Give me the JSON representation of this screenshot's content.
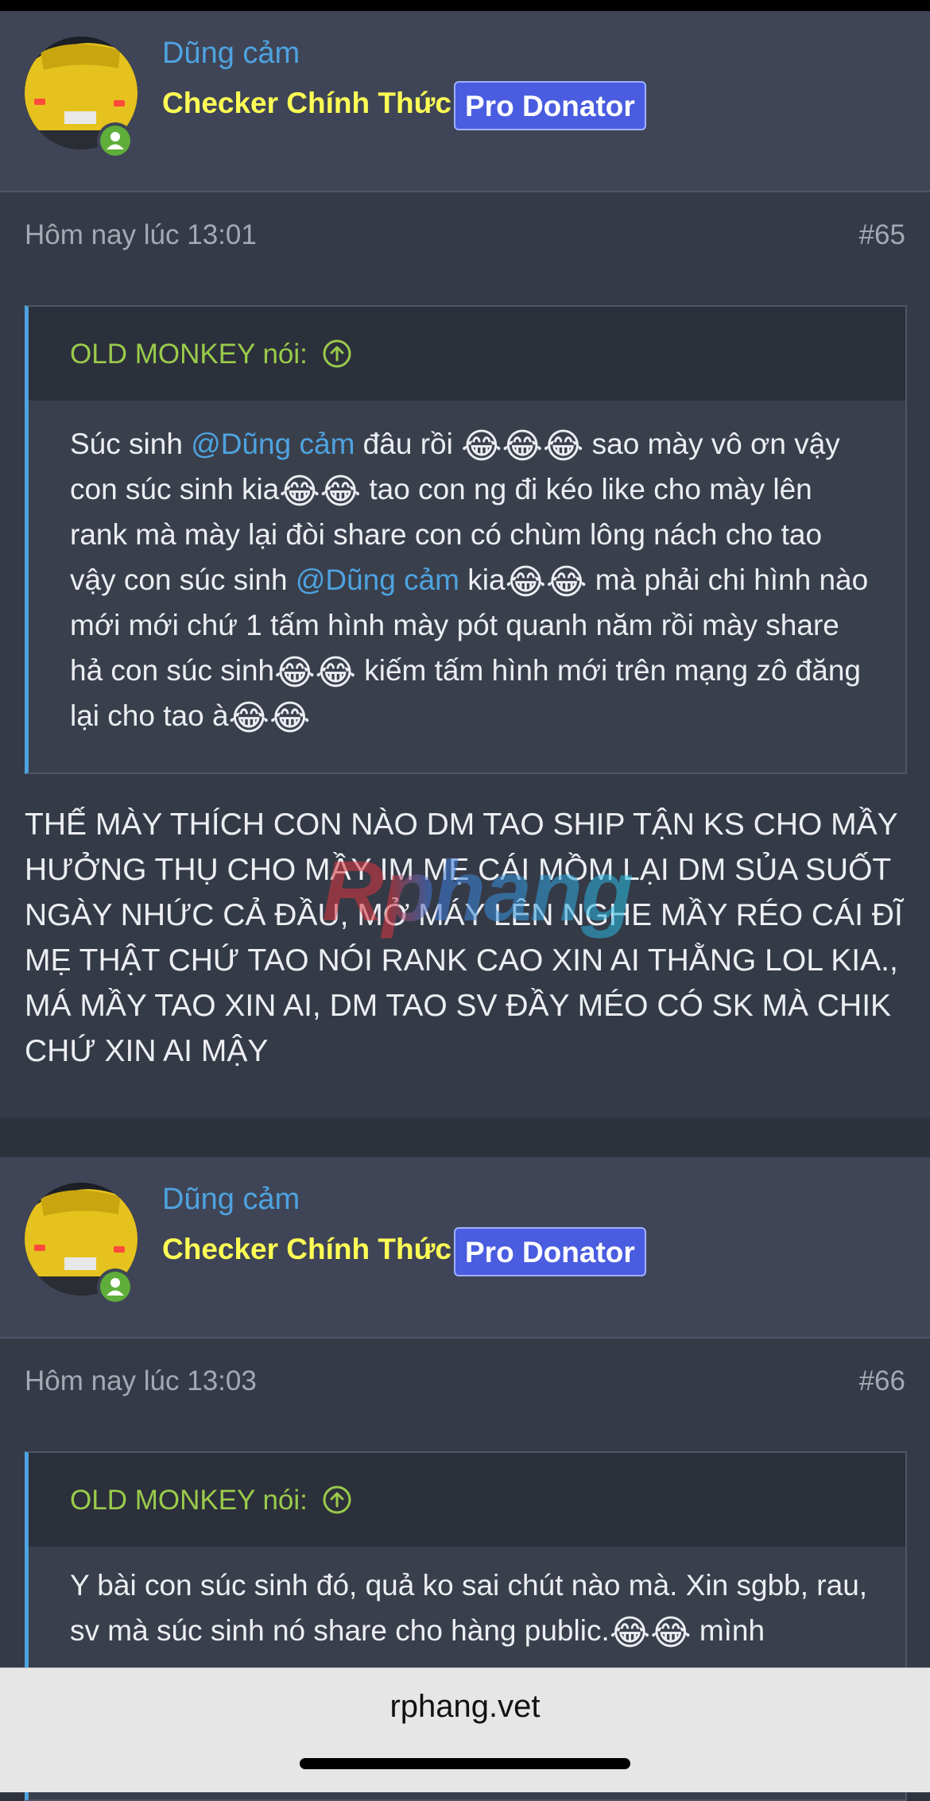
{
  "posts": [
    {
      "username": "Dũng cảm",
      "user_title": "Checker Chính Thức",
      "badge": "Pro Donator",
      "time": "Hôm nay lúc 13:01",
      "post_number": "#65",
      "quote": {
        "author_label": "OLD MONKEY nói:",
        "text": [
          "Súc sinh ",
          "@Dũng cảm",
          " đâu rồi ",
          "😂😂😂",
          " sao mày vô ơn vậy con súc sinh kia",
          "😂😂",
          " tao con ng đi kéo like cho mày lên rank mà mày lại đòi share con có chùm lông nách cho tao vậy con súc sinh ",
          "@Dũng cảm",
          " kia",
          "😂😂",
          " mà phải chi hình nào mới mới chứ 1 tấm hình mày pót quanh năm rồi mày share hả con súc sinh",
          "😂😂",
          " kiếm tấm hình mới trên mạng zô đăng lại cho tao à",
          "😂😂"
        ]
      },
      "body": "THẾ MÀY THÍCH CON NÀO DM TAO SHIP TẬN KS CHO MẦY HƯỞNG THỤ CHO MẦY IM MẸ CÁI MỒM LẠI DM SỦA SUỐT NGÀY NHỨC CẢ ĐẦU, MỞ MÁY LÊN NGHE MẦY RÉO CÁI ĐĨ MẸ THẬT CHỨ TAO NÓI RANK CAO XIN AI THẰNG LOL KIA., MÁ MẦY TAO XIN AI, DM TAO SV ĐẦY MÉO CÓ SK MÀ CHIK CHỨ XIN AI MẬY"
    },
    {
      "username": "Dũng cảm",
      "user_title": "Checker Chính Thức",
      "badge": "Pro Donator",
      "time": "Hôm nay lúc 13:03",
      "post_number": "#66",
      "quote": {
        "author_label": "OLD MONKEY nói:",
        "text": [
          "Y bài con súc sinh đó, quả ko sai chút nào mà. Xin sgbb, rau, sv mà súc sinh nó share cho hàng public.",
          "😂😂",
          " mình"
        ]
      }
    }
  ],
  "watermark": "Rphang",
  "browser": {
    "url": "rphang.vet"
  },
  "icons": {
    "online_status": "online-status-icon",
    "quote_jump": "arrow-up-circle-icon"
  },
  "colors": {
    "username": "#4ea3e0",
    "user_title": "#ffff55",
    "badge_bg": "#4a5ce0",
    "quote_author": "#9acb4b",
    "online": "#5fae3a"
  }
}
